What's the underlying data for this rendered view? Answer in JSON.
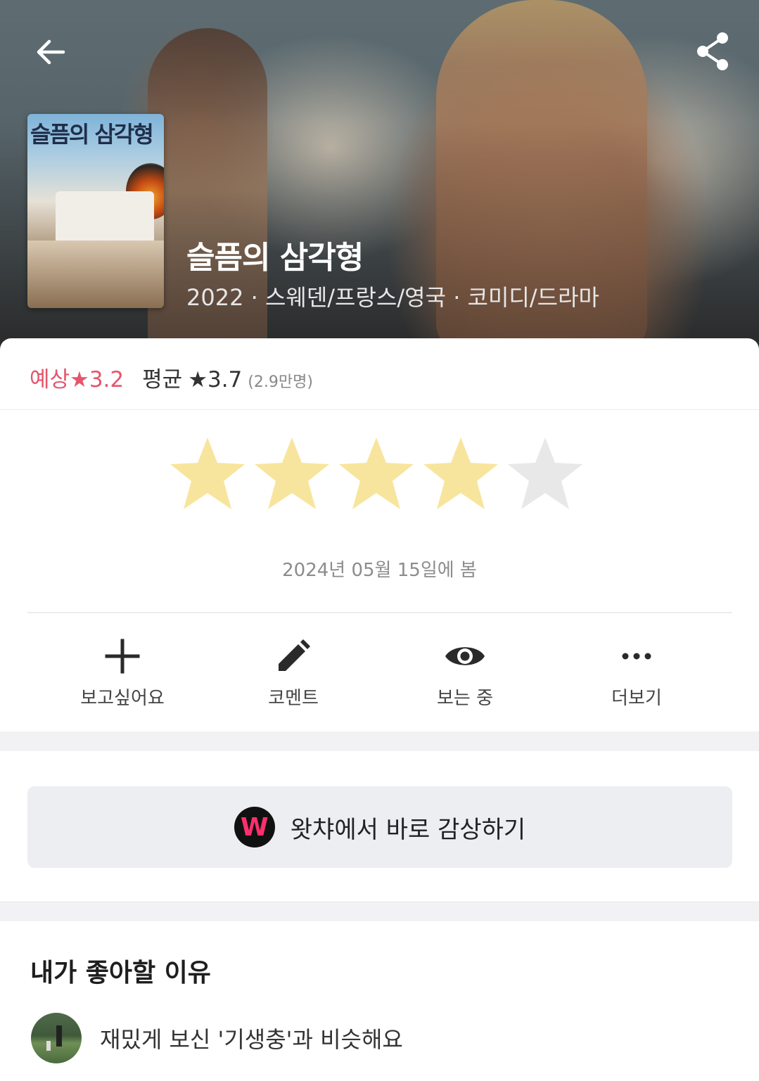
{
  "movie": {
    "title": "슬픔의 삼각형",
    "meta": "2022 · 스웨덴/프랑스/영국 · 코미디/드라마",
    "poster_title": "슬픔의 삼각형"
  },
  "rating": {
    "predicted_label": "예상",
    "predicted_value": "★3.2",
    "average_label": "평균",
    "average_value": "★3.7",
    "count": "(2.9만명)",
    "my_stars": 4,
    "max_stars": 5,
    "watched_date": "2024년 05월 15일에 봄"
  },
  "actions": [
    {
      "label": "보고싶어요",
      "icon": "plus-icon"
    },
    {
      "label": "코멘트",
      "icon": "pencil-icon"
    },
    {
      "label": "보는 중",
      "icon": "eye-icon"
    },
    {
      "label": "더보기",
      "icon": "more-icon"
    }
  ],
  "watch_button": {
    "logo_letter": "W",
    "label": "왓챠에서 바로 감상하기"
  },
  "reasons": {
    "title": "내가 좋아할 이유",
    "items": [
      {
        "text": "재밌게 보신 '기생충'과 비슷해요"
      }
    ]
  },
  "colors": {
    "predicted": "#e4566c",
    "star_filled": "#f8e59d",
    "star_empty": "#e8e8e8",
    "watcha_pink": "#ff2f6e"
  }
}
